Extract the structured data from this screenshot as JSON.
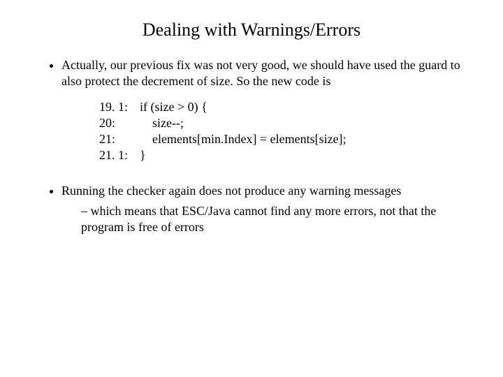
{
  "title": "Dealing with Warnings/Errors",
  "bullets": {
    "b1": "Actually, our previous fix was not very good, we should have used the guard to also protect the decrement of size. So the new code is",
    "b2": "Running the checker again does not produce any warning messages",
    "b2_sub": "which means that ESC/Java cannot find any more errors, not that the program is free of errors"
  },
  "code": {
    "l1_num": "19. 1:",
    "l1_txt": "if (size > 0) {",
    "l2_num": "20:",
    "l2_txt": "    size--;",
    "l3_num": "21:",
    "l3_txt": "    elements[min.Index] = elements[size];",
    "l4_num": "21. 1:",
    "l4_txt": "}"
  }
}
